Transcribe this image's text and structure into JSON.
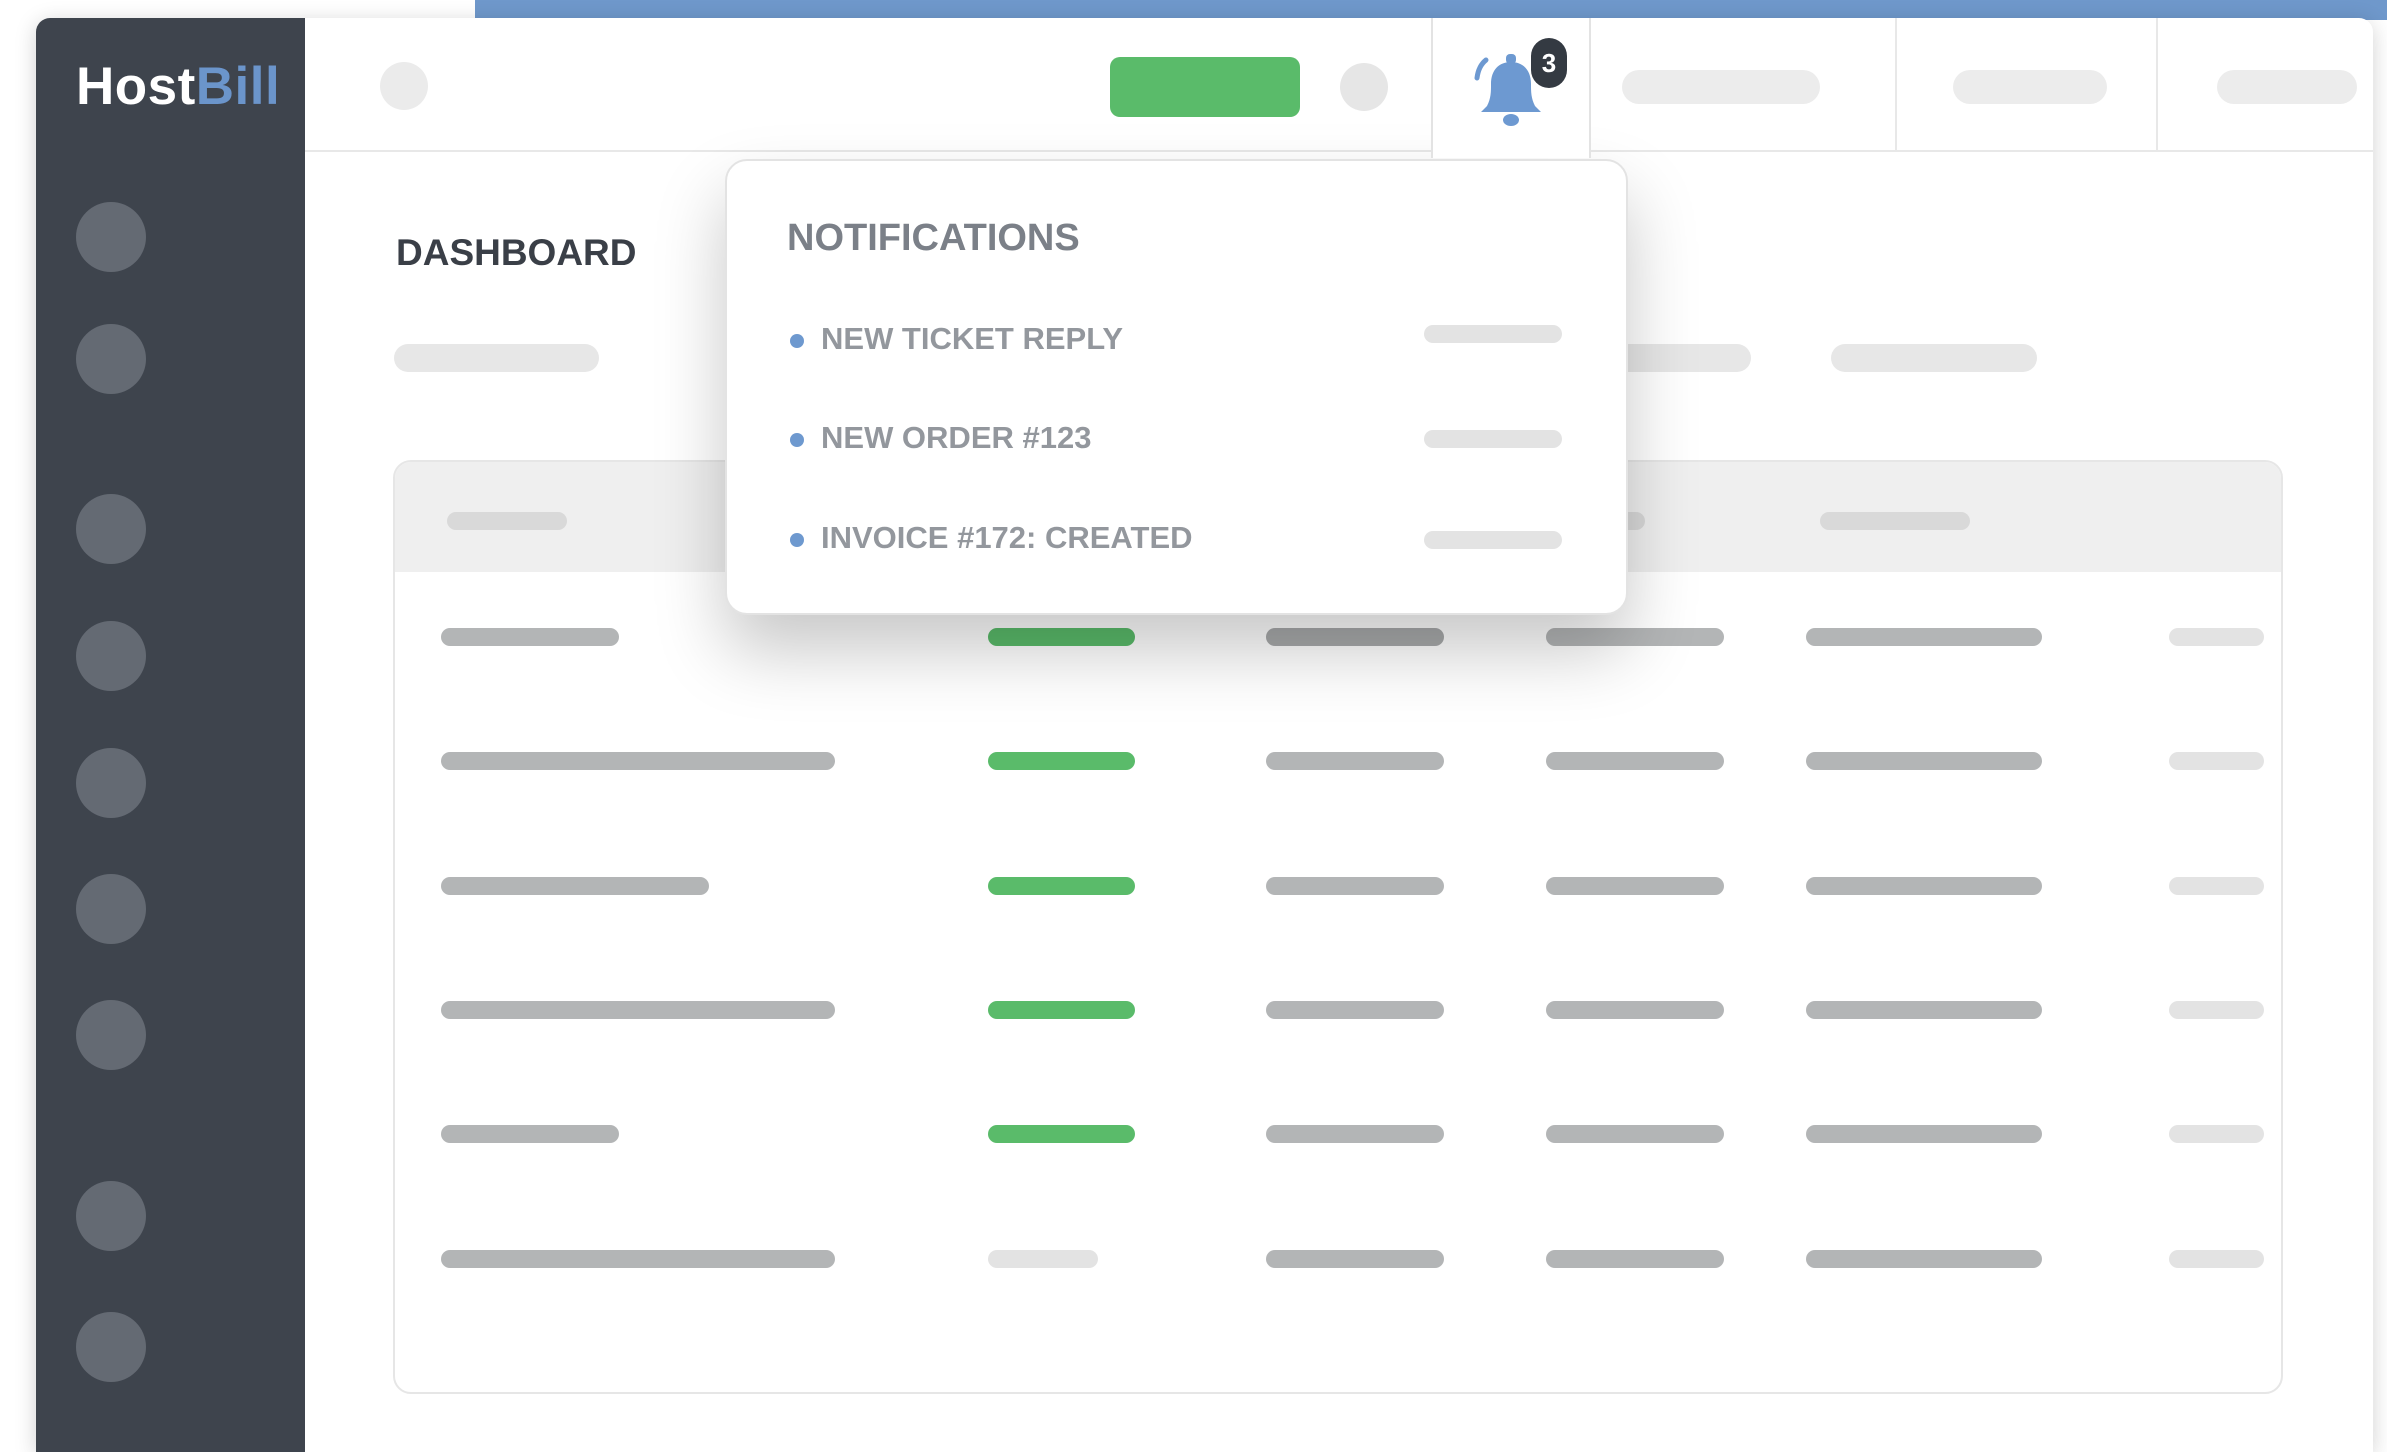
{
  "colors": {
    "screen_strip": "#6f98cb",
    "sidebar_bg": "#3e444d",
    "logo_accent": "#6b95cb",
    "success_green": "#5abb6a",
    "bell_blue": "#6d99d1",
    "badge_bg": "#343a42",
    "placeholder_gray": "#b3b5b6",
    "placeholder_light": "#e3e3e3"
  },
  "sidebar": {
    "logo_part1": "Host",
    "logo_part2": "Bill",
    "icons": [
      "nav-icon-1",
      "nav-icon-2",
      "nav-icon-3",
      "nav-icon-4",
      "nav-icon-5",
      "nav-icon-6",
      "nav-icon-7",
      "nav-icon-8",
      "nav-icon-9"
    ]
  },
  "header": {
    "notification_count": "3",
    "icon": "bell-icon"
  },
  "notifications": {
    "title": "NOTIFICATIONS",
    "items": [
      {
        "label": "NEW TICKET REPLY"
      },
      {
        "label": "NEW ORDER #123"
      },
      {
        "label": "INVOICE #172: CREATED"
      }
    ]
  },
  "main": {
    "page_title": "DASHBOARD"
  }
}
